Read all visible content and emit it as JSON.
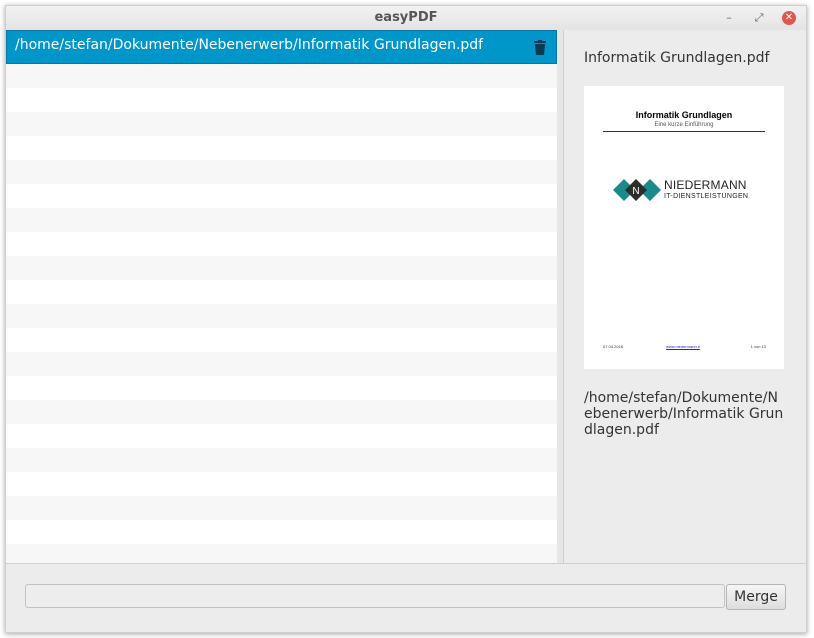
{
  "window": {
    "title": "easyPDF",
    "minimize_glyph": "–",
    "maximize_glyph": "⤢",
    "close_glyph": "✕"
  },
  "files": [
    {
      "path": "/home/stefan/Dokumente/Nebenerwerb/Informatik Grundlagen.pdf",
      "selected": true
    }
  ],
  "preview": {
    "filename": "Informatik Grundlagen.pdf",
    "full_path": "/home/stefan/Dokumente/Nebenerwerb/Informatik Grundlagen.pdf",
    "thumbnail": {
      "title": "Informatik Grundlagen",
      "subtitle": "Eine kurze Einführung",
      "brand_line1": "NIEDERMANN",
      "brand_line2": "IT-DIENSTLEISTUNGEN",
      "logo_letter": "N",
      "footer_left": "07.04.2018",
      "footer_middle": "www.niedermann.it",
      "footer_right": "1 von 13"
    }
  },
  "bottom": {
    "output_value": "",
    "merge_label": "Merge"
  },
  "colors": {
    "selection": "#0096c9",
    "logo_teal": "#1a8a8c",
    "logo_dark": "#2d2d2d",
    "close_button": "#e0574e"
  },
  "icons": {
    "trash": "trash-icon",
    "close": "close-icon",
    "minimize": "minimize-icon",
    "maximize": "maximize-icon"
  }
}
